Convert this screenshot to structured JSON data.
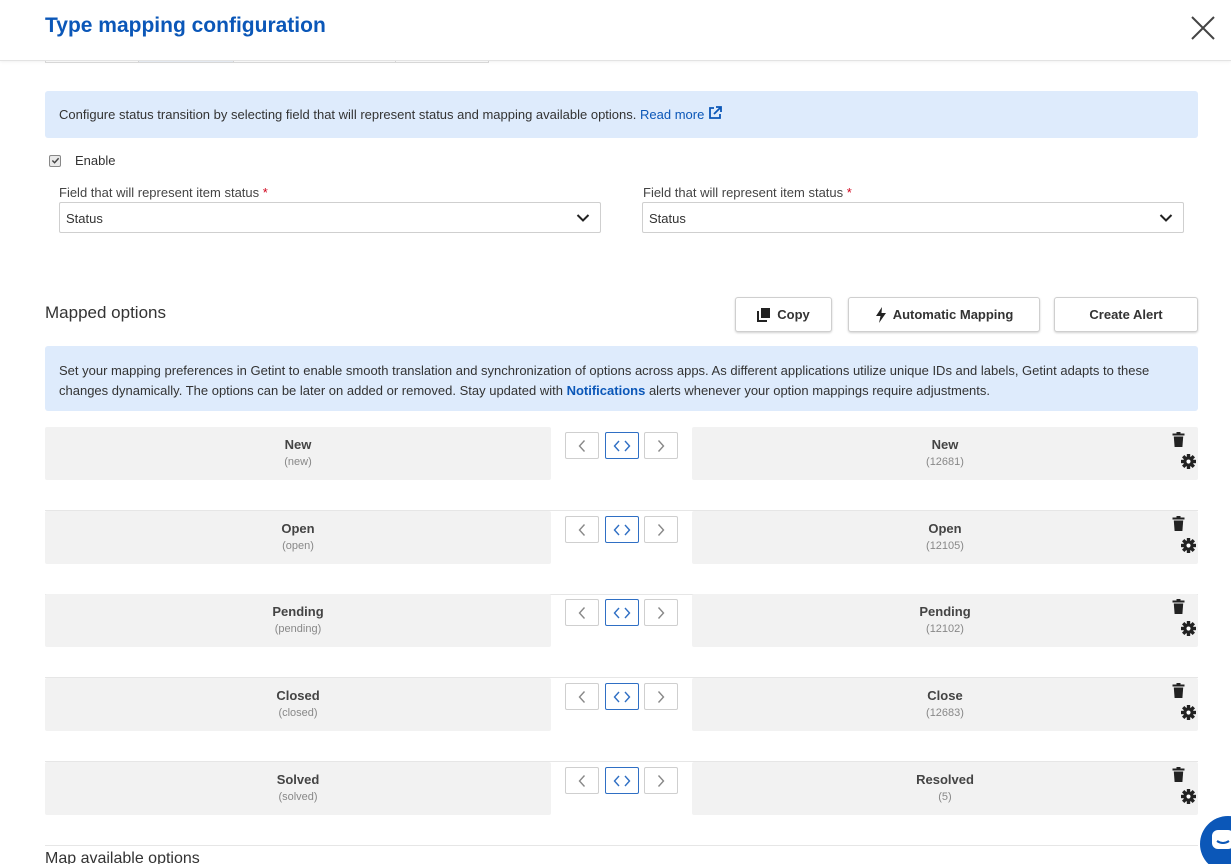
{
  "header": {
    "title": "Type mapping configuration"
  },
  "info": {
    "text": "Configure status transition by selecting field that will represent status and mapping available options.",
    "read_more": "Read more"
  },
  "enable": {
    "label": "Enable",
    "checked": true
  },
  "fields": {
    "left": {
      "label": "Field that will represent item status",
      "required_mark": "*",
      "value": "Status"
    },
    "right": {
      "label": "Field that will represent item status",
      "required_mark": "*",
      "value": "Status"
    }
  },
  "mapped": {
    "title": "Mapped options",
    "copy_label": "Copy",
    "auto_label": "Automatic Mapping",
    "alert_label": "Create Alert"
  },
  "notice": {
    "text_before": "Set your mapping preferences in Getint to enable smooth translation and synchronization of options across apps. As different applications utilize unique IDs and labels, Getint adapts to these changes dynamically. The options can be later on added or removed. Stay updated with",
    "link": "Notifications",
    "text_after": "alerts whenever your option mappings require adjustments."
  },
  "rows": [
    {
      "left_label": "New",
      "left_id": "(new)",
      "right_label": "New",
      "right_id": "(12681)"
    },
    {
      "left_label": "Open",
      "left_id": "(open)",
      "right_label": "Open",
      "right_id": "(12105)"
    },
    {
      "left_label": "Pending",
      "left_id": "(pending)",
      "right_label": "Pending",
      "right_id": "(12102)"
    },
    {
      "left_label": "Closed",
      "left_id": "(closed)",
      "right_label": "Close",
      "right_id": "(12683)"
    },
    {
      "left_label": "Solved",
      "left_id": "(solved)",
      "right_label": "Resolved",
      "right_id": "(5)"
    }
  ],
  "map_available": {
    "title": "Map available options"
  },
  "colors": {
    "brand_blue": "#0b57b8",
    "info_bg": "#deebfc",
    "option_bg": "#f2f2f2"
  }
}
